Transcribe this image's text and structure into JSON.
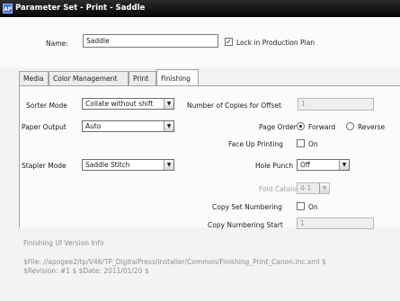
{
  "window": {
    "title": "Parameter Set - Print - Saddle",
    "icon": "apogee-app-icon"
  },
  "header": {
    "name_label": "Name:",
    "name_value": "Saddle",
    "lock_label": "Lock in Production Plan",
    "lock_checked": true
  },
  "tabs": [
    {
      "label": "Media",
      "active": false
    },
    {
      "label": "Color Management",
      "active": false
    },
    {
      "label": "Print",
      "active": false
    },
    {
      "label": "Finishing",
      "active": true
    }
  ],
  "finishing": {
    "sorter_mode_label": "Sorter Mode",
    "sorter_mode_value": "Collate without shift",
    "copies_offset_label": "Number of Copies for Offset",
    "copies_offset_value": "1",
    "paper_output_label": "Paper Output",
    "paper_output_value": "Auto",
    "page_order_label": "Page Order",
    "page_order_forward": "Forward",
    "page_order_reverse": "Reverse",
    "page_order_selected": "Forward",
    "face_up_label": "Face Up Printing",
    "face_up_on": "On",
    "stapler_mode_label": "Stapler Mode",
    "stapler_mode_value": "Saddle Stitch",
    "hole_punch_label": "Hole Punch",
    "hole_punch_value": "Off",
    "fold_catalog_label": "Fold Catalog",
    "fold_catalog_value": "4-1",
    "copy_set_numbering_label": "Copy Set Numbering",
    "copy_set_numbering_on": "On",
    "copy_numbering_start_label": "Copy Numbering Start",
    "copy_numbering_start_value": "1"
  },
  "footer": {
    "version_title": "Finishing UI Version Info",
    "file_line": "$File: //apogee2/tp/V46/TP_DigitalPress/installer/Common/Finishing_Print_Canon.inc.xml $",
    "revision_line": "$Revision: #1 $ $Date: 2011/01/20 $"
  }
}
